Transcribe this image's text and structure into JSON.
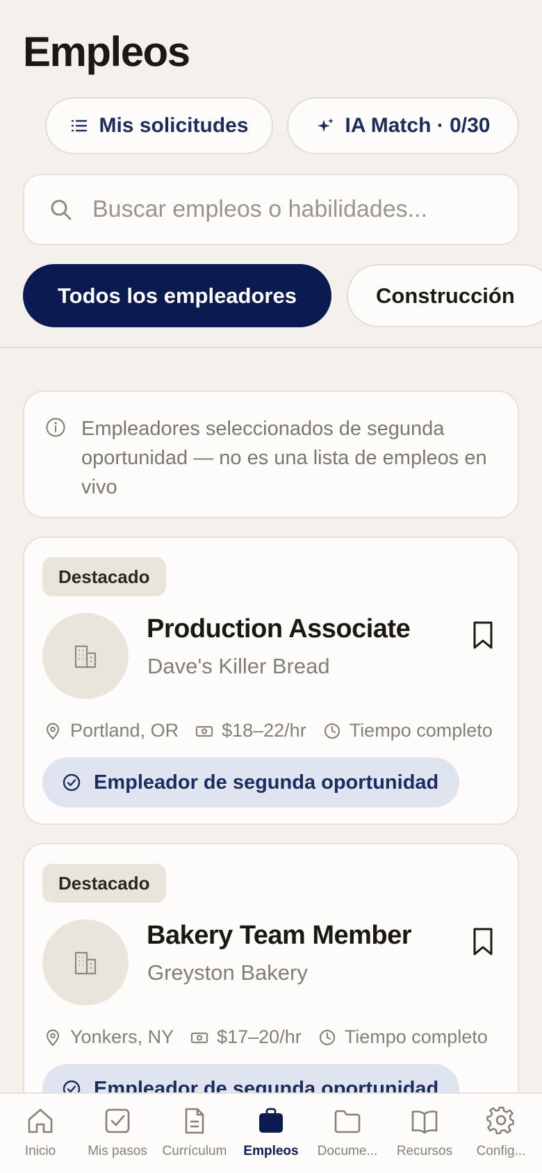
{
  "header": {
    "title": "Empleos"
  },
  "actions": {
    "applications_label": "Mis solicitudes",
    "ai_match_label": "IA Match · 0/30"
  },
  "search": {
    "placeholder": "Buscar empleos o habilidades..."
  },
  "filters": [
    {
      "label": "Todos los empleadores",
      "active": true
    },
    {
      "label": "Construcción",
      "active": false
    }
  ],
  "notice": {
    "text": "Empleadores seleccionados de segunda oportunidad — no es una lista de empleos en vivo"
  },
  "jobs": [
    {
      "badge": "Destacado",
      "title": "Production Associate",
      "company": "Dave's Killer Bread",
      "location": "Portland, OR",
      "pay": "$18–22/hr",
      "type": "Tiempo completo",
      "tag": "Empleador de segunda oportunidad"
    },
    {
      "badge": "Destacado",
      "title": "Bakery Team Member",
      "company": "Greyston Bakery",
      "location": "Yonkers, NY",
      "pay": "$17–20/hr",
      "type": "Tiempo completo",
      "tag": "Empleador de segunda oportunidad"
    }
  ],
  "tabbar": {
    "active": "Empleos",
    "items": [
      {
        "label": "Inicio",
        "icon": "home-icon"
      },
      {
        "label": "Mis pasos",
        "icon": "checkbox-icon"
      },
      {
        "label": "Currículum",
        "icon": "document-icon"
      },
      {
        "label": "Empleos",
        "icon": "briefcase-icon"
      },
      {
        "label": "Docume...",
        "icon": "folder-icon"
      },
      {
        "label": "Recursos",
        "icon": "book-icon"
      },
      {
        "label": "Config...",
        "icon": "gear-icon"
      }
    ]
  },
  "colors": {
    "background": "#f4f1ec",
    "primary_navy": "#0c1a52",
    "tag_background": "#e0e3f0",
    "muted_text": "#847f76"
  }
}
